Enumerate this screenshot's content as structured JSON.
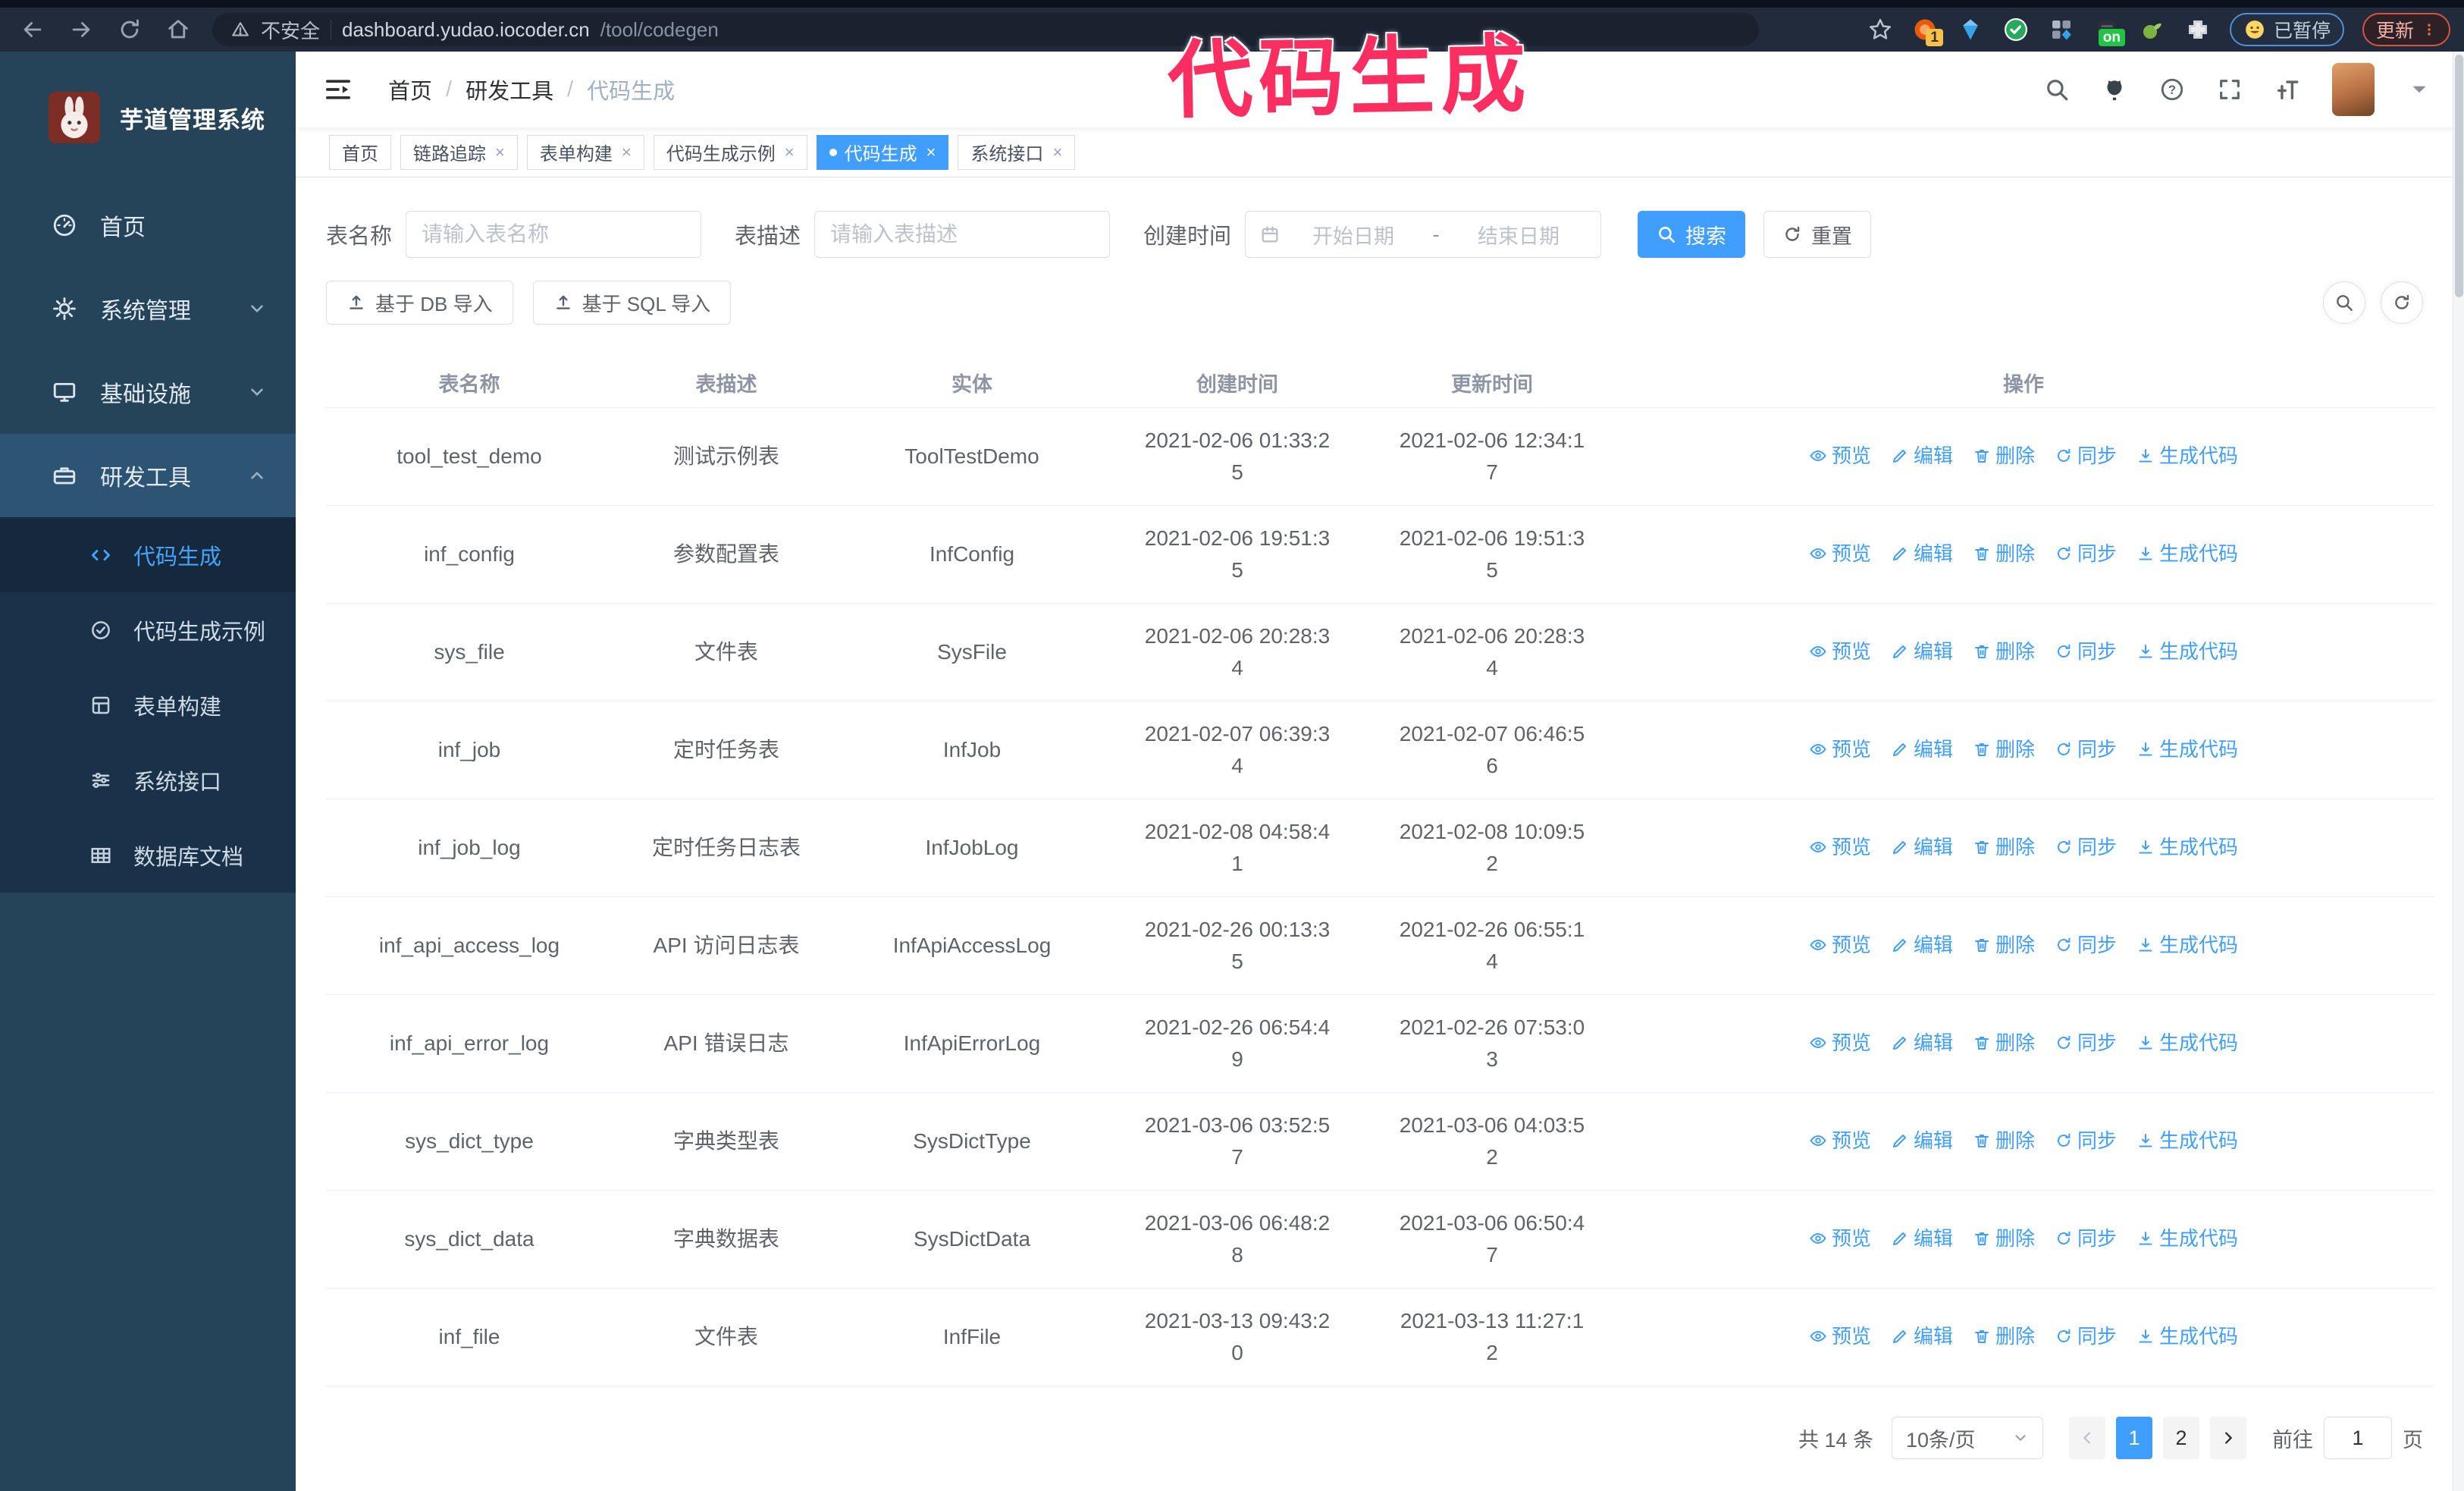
{
  "browser": {
    "security_label": "不安全",
    "url_host": "dashboard.yudao.iocoder.cn",
    "url_path": "/tool/codegen",
    "ext_badge_1": "1",
    "ext_badge_on": "on",
    "paused_label": "已暂停",
    "update_label": "更新"
  },
  "annotation": {
    "text": "代码生成"
  },
  "sidebar": {
    "logo_title": "芋道管理系统",
    "items": [
      {
        "label": "首页",
        "name": "home",
        "icon": "dashboard"
      },
      {
        "label": "系统管理",
        "name": "system-management",
        "icon": "gear",
        "chevron": "down"
      },
      {
        "label": "基础设施",
        "name": "infrastructure",
        "icon": "monitor",
        "chevron": "down"
      },
      {
        "label": "研发工具",
        "name": "dev-tools",
        "icon": "toolbox",
        "chevron": "up",
        "active": true
      }
    ],
    "subitems": [
      {
        "label": "代码生成",
        "name": "codegen",
        "icon": "code",
        "active": true
      },
      {
        "label": "代码生成示例",
        "name": "codegen-example",
        "icon": "badge-check"
      },
      {
        "label": "表单构建",
        "name": "form-builder",
        "icon": "form-grid"
      },
      {
        "label": "系统接口",
        "name": "system-api",
        "icon": "sliders"
      },
      {
        "label": "数据库文档",
        "name": "db-doc",
        "icon": "db-table"
      }
    ]
  },
  "header": {
    "breadcrumb": [
      "首页",
      "研发工具",
      "代码生成"
    ]
  },
  "tags": [
    {
      "label": "首页",
      "closable": false,
      "active": false
    },
    {
      "label": "链路追踪",
      "closable": true,
      "active": false
    },
    {
      "label": "表单构建",
      "closable": true,
      "active": false
    },
    {
      "label": "代码生成示例",
      "closable": true,
      "active": false
    },
    {
      "label": "代码生成",
      "closable": true,
      "active": true
    },
    {
      "label": "系统接口",
      "closable": true,
      "active": false
    }
  ],
  "filters": {
    "name_label": "表名称",
    "name_placeholder": "请输入表名称",
    "desc_label": "表描述",
    "desc_placeholder": "请输入表描述",
    "date_label": "创建时间",
    "date_start_placeholder": "开始日期",
    "date_separator": "-",
    "date_end_placeholder": "结束日期",
    "search_label": "搜索",
    "reset_label": "重置"
  },
  "toolbar": {
    "import_db_label": "基于 DB 导入",
    "import_sql_label": "基于 SQL 导入"
  },
  "table": {
    "columns": [
      "表名称",
      "表描述",
      "实体",
      "创建时间",
      "更新时间",
      "操作"
    ],
    "actions": [
      {
        "label": "预览",
        "name": "preview",
        "icon": "eye"
      },
      {
        "label": "编辑",
        "name": "edit",
        "icon": "edit"
      },
      {
        "label": "删除",
        "name": "delete",
        "icon": "trash"
      },
      {
        "label": "同步",
        "name": "sync",
        "icon": "sync"
      },
      {
        "label": "生成代码",
        "name": "generate-code",
        "icon": "download"
      }
    ],
    "rows": [
      {
        "name": "tool_test_demo",
        "desc": "测试示例表",
        "entity": "ToolTestDemo",
        "created": "2021-02-06 01:33:25",
        "updated": "2021-02-06 12:34:17"
      },
      {
        "name": "inf_config",
        "desc": "参数配置表",
        "entity": "InfConfig",
        "created": "2021-02-06 19:51:35",
        "updated": "2021-02-06 19:51:35"
      },
      {
        "name": "sys_file",
        "desc": "文件表",
        "entity": "SysFile",
        "created": "2021-02-06 20:28:34",
        "updated": "2021-02-06 20:28:34"
      },
      {
        "name": "inf_job",
        "desc": "定时任务表",
        "entity": "InfJob",
        "created": "2021-02-07 06:39:34",
        "updated": "2021-02-07 06:46:56"
      },
      {
        "name": "inf_job_log",
        "desc": "定时任务日志表",
        "entity": "InfJobLog",
        "created": "2021-02-08 04:58:41",
        "updated": "2021-02-08 10:09:52"
      },
      {
        "name": "inf_api_access_log",
        "desc": "API 访问日志表",
        "entity": "InfApiAccessLog",
        "created": "2021-02-26 00:13:35",
        "updated": "2021-02-26 06:55:14"
      },
      {
        "name": "inf_api_error_log",
        "desc": "API 错误日志",
        "entity": "InfApiErrorLog",
        "created": "2021-02-26 06:54:49",
        "updated": "2021-02-26 07:53:03"
      },
      {
        "name": "sys_dict_type",
        "desc": "字典类型表",
        "entity": "SysDictType",
        "created": "2021-03-06 03:52:57",
        "updated": "2021-03-06 04:03:52"
      },
      {
        "name": "sys_dict_data",
        "desc": "字典数据表",
        "entity": "SysDictData",
        "created": "2021-03-06 06:48:28",
        "updated": "2021-03-06 06:50:47"
      },
      {
        "name": "inf_file",
        "desc": "文件表",
        "entity": "InfFile",
        "created": "2021-03-13 09:43:20",
        "updated": "2021-03-13 11:27:12"
      }
    ]
  },
  "pagination": {
    "total_label": "共 14 条",
    "page_size_label": "10条/页",
    "pages": [
      {
        "label": "1",
        "active": true
      },
      {
        "label": "2",
        "active": false
      }
    ],
    "goto_label": "前往",
    "goto_value": "1",
    "goto_suffix": "页"
  },
  "colors": {
    "accent": "#409eff",
    "sidebar_bg": "#264459",
    "submenu_bg": "#1a3249",
    "annotation": "#fb2e62"
  }
}
